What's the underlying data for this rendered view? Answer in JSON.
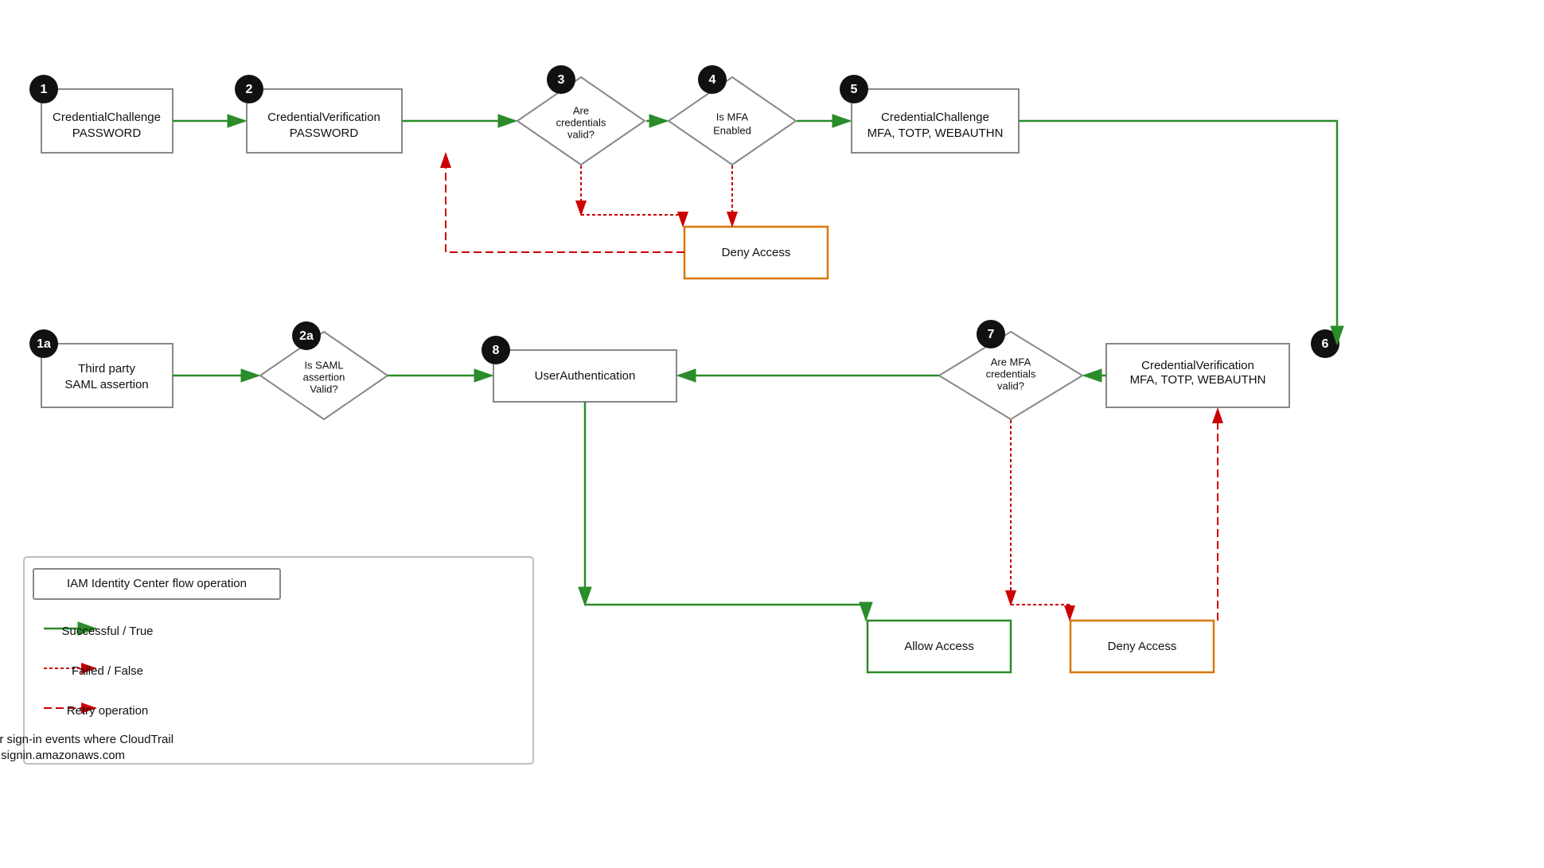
{
  "nodes": {
    "n1": {
      "label": "CredentialChallenge\nPASSWORD",
      "num": "1"
    },
    "n1a": {
      "label": "Third party\nSAML assertion",
      "num": "1a"
    },
    "n2": {
      "label": "CredentialVerification\nPASSWORD",
      "num": "2"
    },
    "n2a": {
      "label": "Is SAML\nassertion\nValid?",
      "num": "2a"
    },
    "n3": {
      "label": "Are\ncredentials\nvalid?",
      "num": "3"
    },
    "n4": {
      "label": "Is MFA\nEnabled",
      "num": "4"
    },
    "n5": {
      "label": "CredentialChallenge\nMFA, TOTP, WEBAUTHN",
      "num": "5"
    },
    "n6": {
      "label": "CredentialVerification\nMFA, TOTP, WEBAUTHN",
      "num": "6"
    },
    "n7": {
      "label": "Are MFA\ncredentials\nvalid?",
      "num": "7"
    },
    "n8": {
      "label": "UserAuthentication",
      "num": "8"
    },
    "deny1": {
      "label": "Deny Access"
    },
    "deny2": {
      "label": "Deny Access"
    },
    "allow": {
      "label": "Allow Access"
    }
  },
  "legend": {
    "title": "IAM Identity Center flow operation",
    "successful": "Successful / True",
    "failed": "Failed / False",
    "retry": "Retry operation",
    "footer": "IAM Identity Center sign-in events where CloudTrail\nsource is signin.amazonaws.com"
  }
}
